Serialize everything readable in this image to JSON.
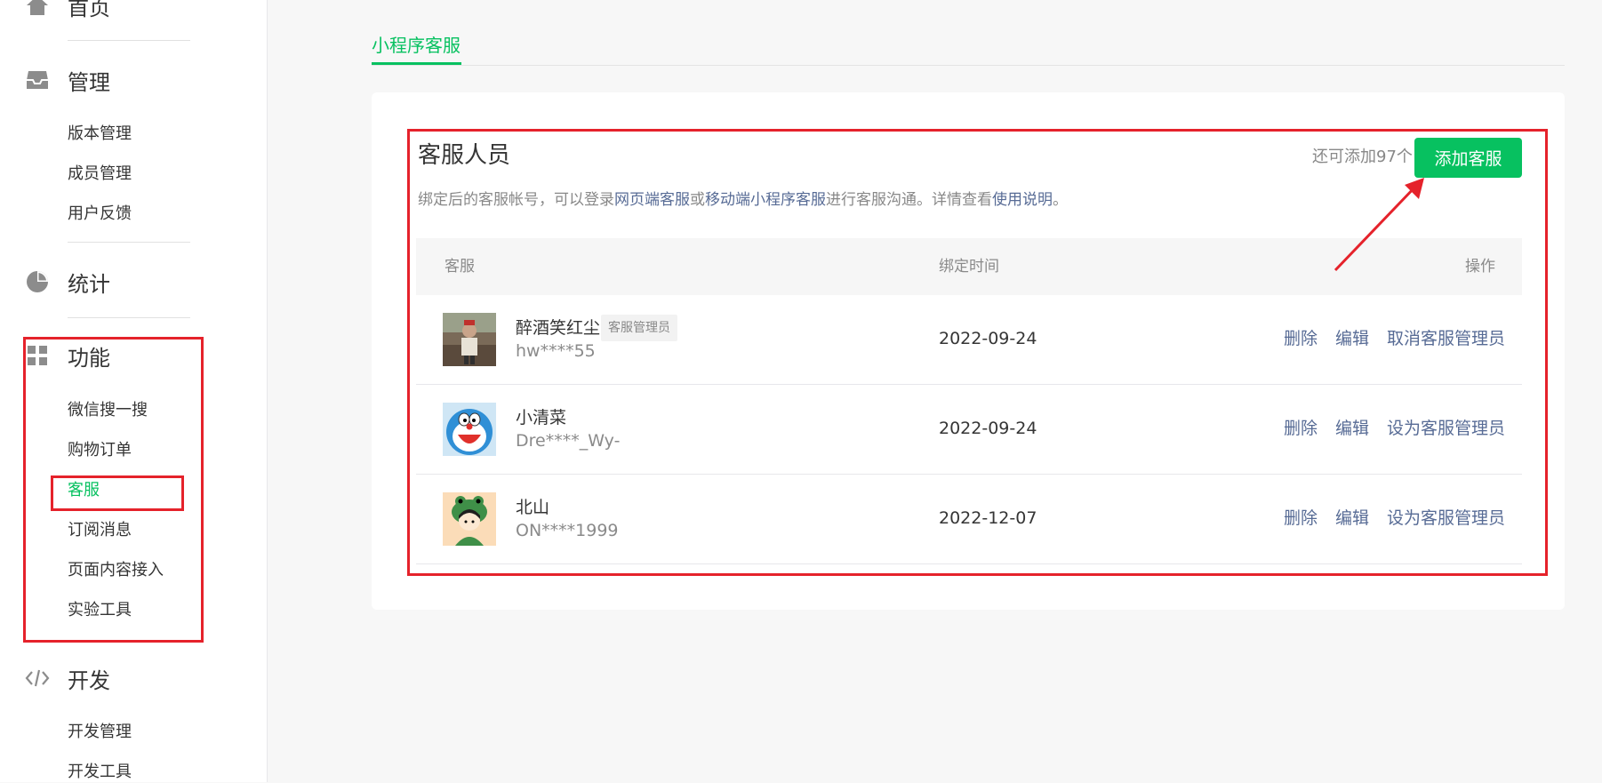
{
  "sidebar": {
    "home_label": "首页",
    "groups": [
      {
        "title": "管理",
        "icon": "inbox-icon",
        "items": [
          "版本管理",
          "成员管理",
          "用户反馈"
        ]
      },
      {
        "title": "统计",
        "icon": "pie-chart-icon",
        "items": []
      },
      {
        "title": "功能",
        "icon": "grid-icon",
        "items": [
          "微信搜一搜",
          "购物订单",
          "客服",
          "订阅消息",
          "页面内容接入",
          "实验工具"
        ]
      },
      {
        "title": "开发",
        "icon": "code-icon",
        "items": [
          "开发管理",
          "开发工具"
        ]
      }
    ],
    "active_item": "客服"
  },
  "tabs": [
    {
      "label": "小程序客服",
      "active": true
    }
  ],
  "section": {
    "title": "客服人员",
    "desc_prefix": "绑定后的客服帐号，可以登录",
    "desc_link1": "网页端客服",
    "desc_or": "或",
    "desc_link2": "移动端小程序客服",
    "desc_middle": "进行客服沟通。详情查看",
    "desc_link3": "使用说明",
    "desc_suffix": "。",
    "remaining": "还可添加97个",
    "add_button": "添加客服"
  },
  "table": {
    "columns": [
      "客服",
      "绑定时间",
      "操作"
    ],
    "rows": [
      {
        "name": "醉酒笑红尘",
        "badge": "客服管理员",
        "account": "hw****55",
        "date": "2022-09-24",
        "actions": [
          "删除",
          "编辑",
          "取消客服管理员"
        ]
      },
      {
        "name": "小清菜",
        "badge": "",
        "account": "Dre****_Wy-",
        "date": "2022-09-24",
        "actions": [
          "删除",
          "编辑",
          "设为客服管理员"
        ]
      },
      {
        "name": "北山",
        "badge": "",
        "account": "ON****1999",
        "date": "2022-12-07",
        "actions": [
          "删除",
          "编辑",
          "设为客服管理员"
        ]
      }
    ]
  },
  "colors": {
    "accent": "#07c160",
    "link": "#576b95",
    "annotation": "#e5222b"
  }
}
